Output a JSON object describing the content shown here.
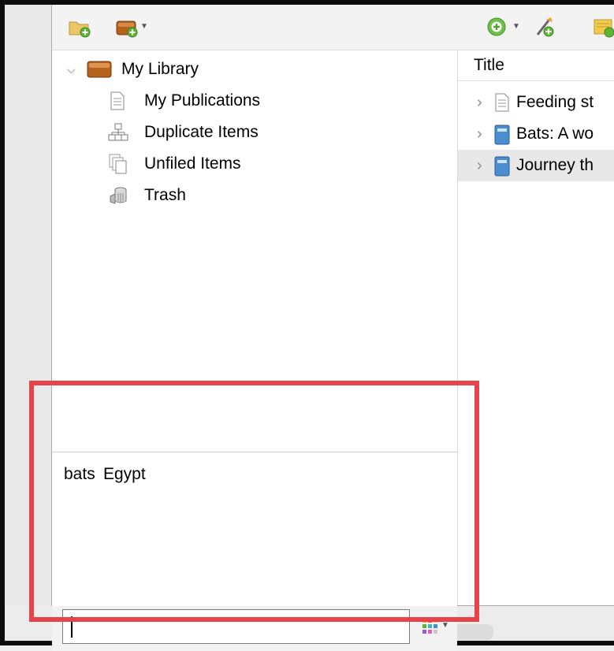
{
  "library": {
    "root": {
      "label": "My Library",
      "icon": "library-box-icon"
    },
    "items": [
      {
        "label": "My Publications",
        "icon": "document-icon"
      },
      {
        "label": "Duplicate Items",
        "icon": "duplicate-icon"
      },
      {
        "label": "Unfiled Items",
        "icon": "unfiled-icon"
      },
      {
        "label": "Trash",
        "icon": "trash-icon"
      }
    ]
  },
  "items_pane": {
    "column_header": "Title",
    "rows": [
      {
        "title": "Feeding st",
        "icon": "document-icon",
        "selected": false
      },
      {
        "title": "Bats: A wo",
        "icon": "book-icon",
        "selected": false
      },
      {
        "title": "Journey th",
        "icon": "book-icon",
        "selected": true
      }
    ]
  },
  "tag_selector": {
    "tags": [
      "bats",
      "Egypt"
    ],
    "filter_value": "",
    "color_button_icon": "tag-colors-icon"
  },
  "toolbar": {
    "buttons": [
      "new-collection-icon",
      "new-library-icon",
      "new-item-icon",
      "add-by-identifier-icon",
      "new-note-icon"
    ]
  },
  "colors": {
    "highlight": "#e8424a",
    "book": "#4a8ed1",
    "library": "#b5621d"
  }
}
